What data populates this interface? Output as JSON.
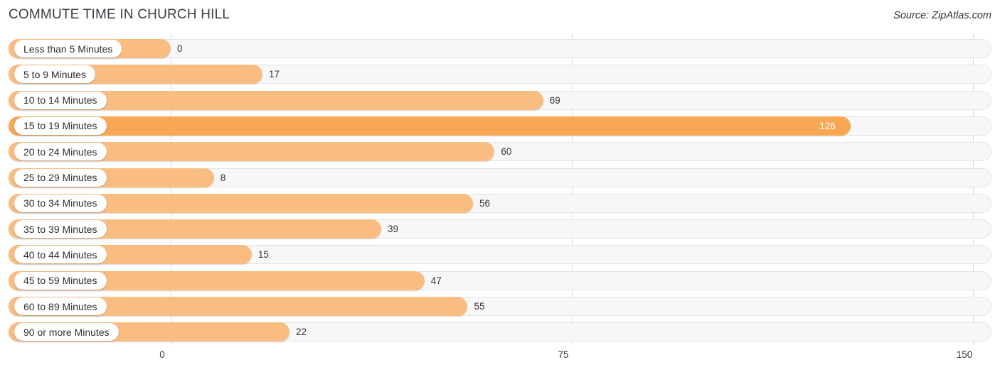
{
  "header": {
    "title": "COMMUTE TIME IN CHURCH HILL",
    "source": "Source: ZipAtlas.com"
  },
  "colors": {
    "bar_normal": "#f9bd82",
    "bar_highlight": "#f9a755",
    "track": "#f7f7f7",
    "track_border": "#e3e3e6",
    "gridline": "#d8d8dc",
    "text": "#34343a",
    "value_inside": "#ffffff"
  },
  "chart_data": {
    "type": "bar",
    "orientation": "horizontal",
    "title": "COMMUTE TIME IN CHURCH HILL",
    "xlabel": "",
    "ylabel": "",
    "xlim": [
      0,
      150
    ],
    "ticks": [
      0,
      75,
      150
    ],
    "tick_labels": [
      "0",
      "75",
      "150"
    ],
    "grid": true,
    "legend": false,
    "categories": [
      "Less than 5 Minutes",
      "5 to 9 Minutes",
      "10 to 14 Minutes",
      "15 to 19 Minutes",
      "20 to 24 Minutes",
      "25 to 29 Minutes",
      "30 to 34 Minutes",
      "35 to 39 Minutes",
      "40 to 44 Minutes",
      "45 to 59 Minutes",
      "60 to 89 Minutes",
      "90 or more Minutes"
    ],
    "values": [
      0,
      17,
      69,
      126,
      60,
      8,
      56,
      39,
      15,
      47,
      55,
      22
    ],
    "value_labels": [
      "0",
      "17",
      "69",
      "126",
      "60",
      "8",
      "56",
      "39",
      "15",
      "47",
      "55",
      "22"
    ],
    "highlight_index": 3
  }
}
